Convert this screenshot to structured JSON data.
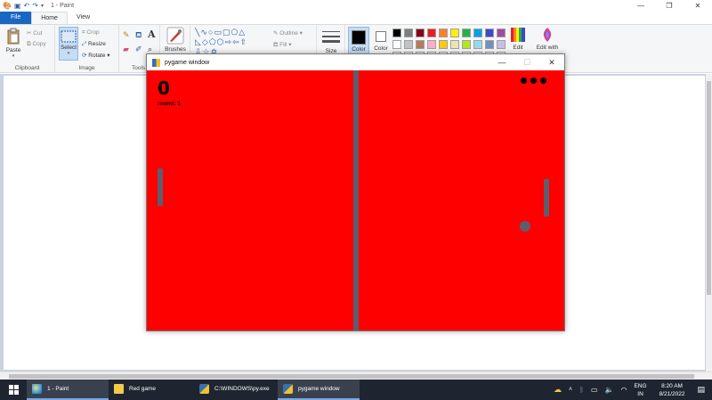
{
  "paint": {
    "window_title": "1 - Paint",
    "tabs": [
      "File",
      "Home",
      "View"
    ],
    "clipboard": {
      "paste": "Paste",
      "cut": "Cut",
      "copy": "Copy",
      "label": "Clipboard"
    },
    "image": {
      "select": "Select",
      "crop": "Crop",
      "resize": "Resize",
      "rotate": "Rotate",
      "label": "Image"
    },
    "tools": {
      "label": "Tools",
      "text_tool": "A"
    },
    "brushes": "Brushes",
    "shapes": {
      "outline": "Outline",
      "fill": "Fill"
    },
    "size": "Size",
    "color1": "Color",
    "color2": "Color",
    "edit_colors": "Edit",
    "edit_with": "Edit with",
    "colors": {
      "primary": "#000000",
      "secondary": "#ffffff",
      "palette_row1": [
        "#000000",
        "#7f7f7f",
        "#880015",
        "#ed1c24",
        "#ff7f27",
        "#fff200",
        "#22b14c",
        "#00a2e8",
        "#3f48cc",
        "#a349a4"
      ],
      "palette_row2": [
        "#ffffff",
        "#c3c3c3",
        "#b97a57",
        "#ffaec9",
        "#ffc90e",
        "#efe4b0",
        "#b5e61d",
        "#99d9ea",
        "#7092be",
        "#c8bfe7"
      ]
    }
  },
  "pygame": {
    "window_title": "pygame window",
    "score": "0",
    "round_text": "round: 1",
    "lives": 3,
    "colors": {
      "background": "#fe0000",
      "objects": "#5c5e6d"
    }
  },
  "taskbar": {
    "items": [
      {
        "label": "1 - Paint",
        "icon": "paint-icon"
      },
      {
        "label": "Red game",
        "icon": "folder-icon"
      },
      {
        "label": "C:\\WINDOWS\\py.exe",
        "icon": "python-console-icon"
      },
      {
        "label": "pygame window",
        "icon": "pygame-icon"
      }
    ],
    "language": "ENG",
    "region": "IN",
    "time": "8:20 AM",
    "date": "8/21/2022"
  }
}
